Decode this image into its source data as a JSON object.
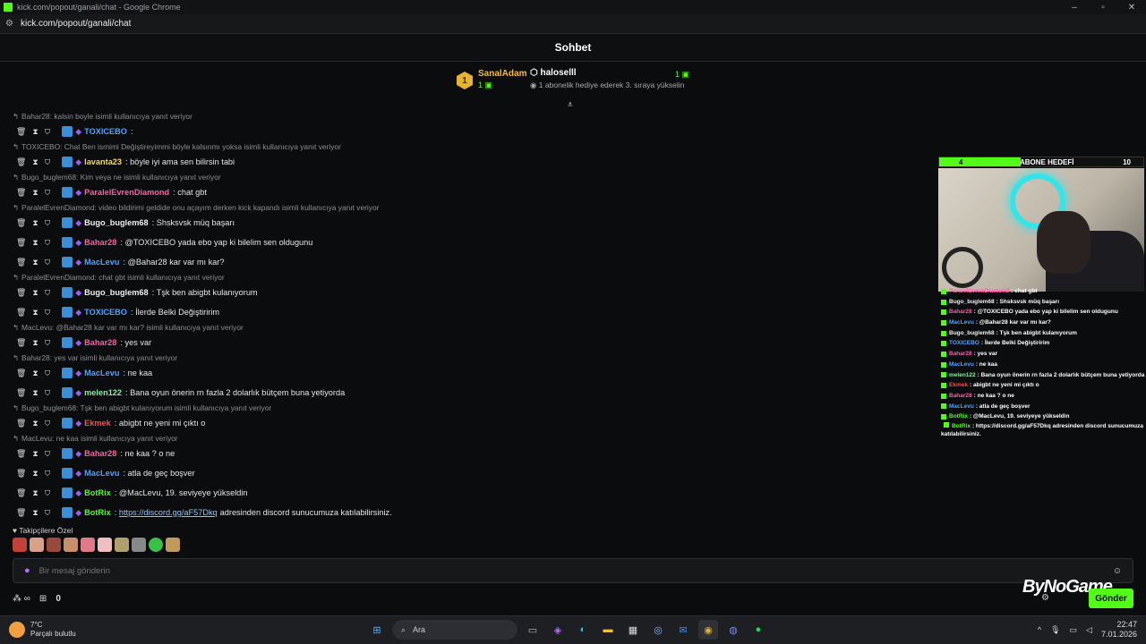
{
  "window": {
    "title": "kick.com/popout/ganali/chat - Google Chrome",
    "url": "kick.com/popout/ganali/chat"
  },
  "header": {
    "title": "Sohbet"
  },
  "leaderboard": {
    "first": {
      "rank": "1",
      "name": "SanalAdam",
      "count": "1"
    },
    "second": {
      "name": "haloselll",
      "count": "1",
      "hint": "1 abonelik hediye ederek 3. sıraya yükselin"
    }
  },
  "messages": [
    {
      "reply": "Bahar28: kalsin boyle isimli kullanıcıya yanıt veriyor",
      "user": "TOXICEBO",
      "text": ""
    },
    {
      "reply": "TOXICEBO: Chat Ben ismimi Değiştireyimmi böyle kalsınmı yoksa isimli kullanıcıya yanıt veriyor",
      "user": "lavanta23",
      "text": "böyle iyi ama sen bilirsin tabi"
    },
    {
      "reply": "Bugo_buglem68: Kim veya ne isimli kullanıcıya yanıt veriyor",
      "user": "ParalelEvrenDiamond",
      "text": "chat gbt"
    },
    {
      "reply": "ParalelEvrenDiamond: video bildirimi geldide onu açayım derken kick kapandı isimli kullanıcıya yanıt veriyor",
      "user": "Bugo_buglem68",
      "text": "Shsksvsk müq başarı"
    },
    {
      "reply": "",
      "user": "Bahar28",
      "text": "@TOXICEBO yada ebo yap ki bilelim sen oldugunu"
    },
    {
      "reply": "",
      "user": "MacLevu",
      "text": "@Bahar28 kar var mı kar?"
    },
    {
      "reply": "ParalelEvrenDiamond: chat gbt isimli kullanıcıya yanıt veriyor",
      "user": "Bugo_buglem68",
      "text": "Tşk ben abigbt kulanıyorum"
    },
    {
      "reply": "",
      "user": "TOXICEBO",
      "text": "İlerde Belki Değiştiririm"
    },
    {
      "reply": "MacLevu: @Bahar28 kar var mı kar? isimli kullanıcıya yanıt veriyor",
      "user": "Bahar28",
      "text": "yes var"
    },
    {
      "reply": "Bahar28: yes var isimli kullanıcıya yanıt veriyor",
      "user": "MacLevu",
      "text": "ne kaa"
    },
    {
      "reply": "",
      "user": "melen122",
      "text": "Bana oyun önerin rn fazla 2 dolarlık bütçem buna yetiyorda"
    },
    {
      "reply": "Bugo_buglem68: Tşk ben abigbt kulanıyorum isimli kullanıcıya yanıt veriyor",
      "user": "Ekmek",
      "text": "abigbt ne yeni mi çıktı o"
    },
    {
      "reply": "MacLevu: ne kaa isimli kullanıcıya yanıt veriyor",
      "user": "Bahar28",
      "text": "ne kaa ? o ne"
    },
    {
      "reply": "",
      "user": "MacLevu",
      "text": "atla de geç boşver"
    },
    {
      "reply": "",
      "user": "BotRix",
      "text": "@MacLevu, 19. seviyeye yükseldin"
    },
    {
      "reply": "",
      "user": "BotRix",
      "link": "https://discord.gg/aF57Dkq",
      "text": "adresinden discord sunucumuza katılabilirsiniz."
    }
  ],
  "followers_label": "Takipçilere Özel",
  "input": {
    "placeholder": "Bir mesaj gönderin"
  },
  "bottom": {
    "points": "0"
  },
  "send_label": "Gönder",
  "brand": "ByNoGame",
  "overlay": {
    "goal": {
      "current": "4",
      "label": "ABONE HEDEFİ",
      "target": "10",
      "progress": 0.4
    },
    "chat": [
      {
        "user": "ParalelEvrenDiamond",
        "text": ": chat gbt"
      },
      {
        "user": "Bugo_buglem68",
        "text": ": Shsksvsk müq başarı"
      },
      {
        "user": "Bahar28",
        "text": ": @TOXICEBO yada ebo yap ki bilelim sen oldugunu"
      },
      {
        "user": "MacLevu",
        "text": ": @Bahar28 kar var mı kar?"
      },
      {
        "user": "Bugo_buglem68",
        "text": ": Tşk ben abigbt kulanıyorum"
      },
      {
        "user": "TOXICEBO",
        "text": ": İlerde Belki Değiştiririm"
      },
      {
        "user": "Bahar28",
        "text": ": yes var"
      },
      {
        "user": "MacLevu",
        "text": ": ne kaa"
      },
      {
        "user": "melen122",
        "text": ": Bana oyun önerin rn fazla 2 dolarlık bütçem buna yetiyorda"
      },
      {
        "user": "Ekmek",
        "text": ": abigbt ne yeni mi çıktı o"
      },
      {
        "user": "Bahar28",
        "text": ": ne kaa ? o ne"
      },
      {
        "user": "MacLevu",
        "text": ": atla de geç boşver"
      },
      {
        "user": "BotRix",
        "text": ": @MacLevu, 19. seviyeye yükseldin"
      },
      {
        "user": "BotRix",
        "text": ": https://discord.gg/aF57Dkq adresinden discord sunucumuza katılabilirsiniz."
      }
    ]
  },
  "taskbar": {
    "temp": "7°C",
    "weather": "Parçalı bulutlu",
    "search": "Ara",
    "time": "22:47",
    "date": "7.01.2026"
  },
  "colors": {
    "accent": "#53fc18",
    "background": "#0b0c0d"
  }
}
